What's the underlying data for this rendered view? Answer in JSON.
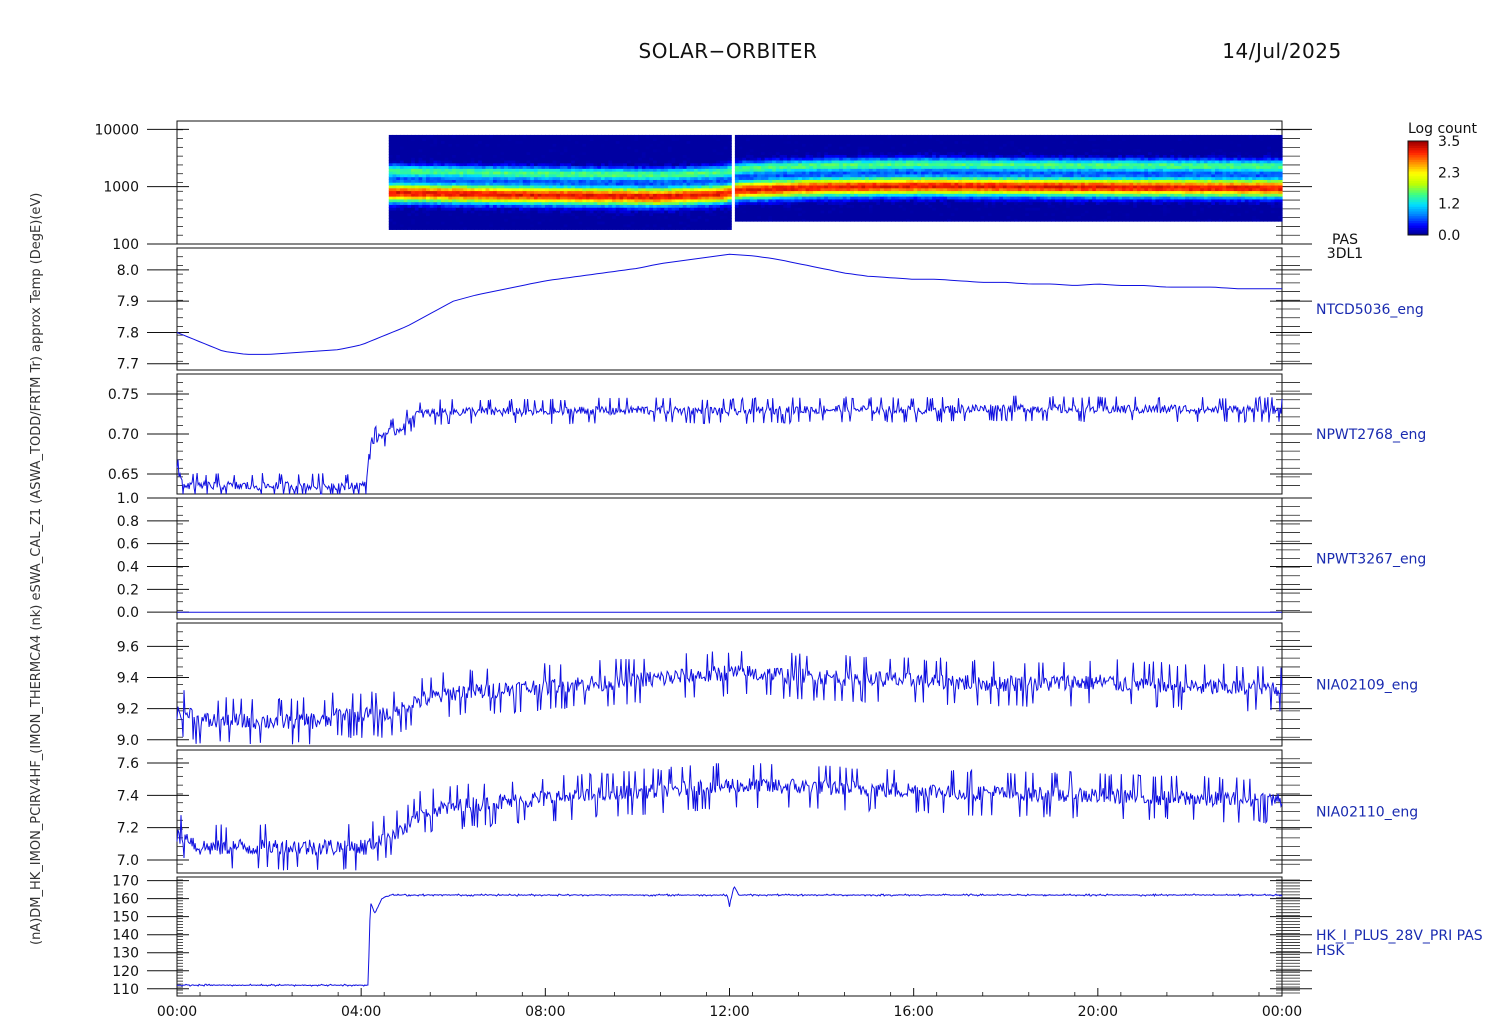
{
  "header": {
    "mission": "SOLAR−ORBITER",
    "date": "14/Jul/2025"
  },
  "left_axis_overlay": "(nA)DM_HK_IMON_PCIRV4HF_(IMON_THERMCA4 (nk) eSWA_CAL_Z1 (ASWA_TODD/FRTM Tr) approx Temp (DegE)(eV)",
  "colors": {
    "trace": "#1010e0",
    "label": "#1a2bb0",
    "colormap": [
      "#000080",
      "#0000ff",
      "#0080ff",
      "#00e0ff",
      "#40ff80",
      "#c0ff00",
      "#ffff00",
      "#ff9000",
      "#ff2000",
      "#a00000"
    ]
  },
  "colorbar": {
    "title": "Log count",
    "ticks": [
      "3.5",
      "2.3",
      "1.2",
      "0.0"
    ],
    "min": 0.0,
    "max": 3.5
  },
  "chart_data": [
    {
      "type": "heatmap",
      "panel": "PAS 3DL1",
      "right_label": [
        "PAS",
        "3DL1"
      ],
      "ylabel": "(eV)",
      "yscale": "log",
      "ylim": [
        100,
        14000
      ],
      "ytick_labels": [
        "10000",
        "1000",
        "100"
      ],
      "yticks": [
        10000,
        1000,
        100
      ],
      "x_start_hours": 4.6,
      "x_end_hours": 24.0,
      "energy_range_eV": [
        180,
        8000
      ],
      "data_gap_hours": [
        12.0,
        12.1
      ],
      "peak_energy_eV": [
        {
          "t": 4.6,
          "e": 800
        },
        {
          "t": 8.0,
          "e": 720
        },
        {
          "t": 10.5,
          "e": 680
        },
        {
          "t": 11.9,
          "e": 760
        },
        {
          "t": 12.2,
          "e": 880
        },
        {
          "t": 14.0,
          "e": 1000
        },
        {
          "t": 16.0,
          "e": 1050
        },
        {
          "t": 20.0,
          "e": 1000
        },
        {
          "t": 24.0,
          "e": 960
        }
      ]
    },
    {
      "type": "line",
      "panel": "NTCD5036_eng",
      "right_label": "NTCD5036_eng",
      "ylabel": "approx Temp (DegC)",
      "ylim": [
        7.68,
        8.07
      ],
      "yticks": [
        7.7,
        7.8,
        7.9,
        8.0
      ],
      "ytick_labels": [
        "7.7",
        "7.8",
        "7.9",
        "8.0"
      ],
      "x": [
        0,
        0.5,
        1,
        1.5,
        2,
        2.5,
        3,
        3.5,
        4,
        4.5,
        5,
        5.5,
        6,
        6.5,
        7,
        7.5,
        8,
        8.5,
        9,
        9.5,
        10,
        10.5,
        11,
        11.5,
        12,
        12.5,
        13,
        13.5,
        14,
        14.5,
        15,
        15.5,
        16,
        16.5,
        17,
        17.5,
        18,
        18.5,
        19,
        19.5,
        20,
        20.5,
        21,
        21.5,
        22,
        22.5,
        23,
        23.5,
        24
      ],
      "y": [
        7.8,
        7.77,
        7.74,
        7.73,
        7.73,
        7.735,
        7.74,
        7.745,
        7.76,
        7.79,
        7.82,
        7.86,
        7.9,
        7.92,
        7.935,
        7.95,
        7.965,
        7.975,
        7.985,
        7.995,
        8.005,
        8.02,
        8.03,
        8.04,
        8.05,
        8.045,
        8.035,
        8.02,
        8.005,
        7.99,
        7.98,
        7.975,
        7.97,
        7.97,
        7.965,
        7.96,
        7.96,
        7.955,
        7.955,
        7.95,
        7.955,
        7.95,
        7.95,
        7.945,
        7.945,
        7.945,
        7.94,
        7.94,
        7.94
      ]
    },
    {
      "type": "line",
      "panel": "NPWT2768_eng",
      "right_label": "NPWT2768_eng",
      "ylabel": "SWA_CAL_Z1 (A)",
      "ylim": [
        0.625,
        0.775
      ],
      "yticks": [
        0.65,
        0.7,
        0.75
      ],
      "ytick_labels": [
        "0.65",
        "0.70",
        "0.75"
      ],
      "x": [
        0,
        0.15,
        0.5,
        2,
        4.1,
        4.2,
        4.5,
        4.8,
        5.2,
        6,
        8,
        10,
        12,
        14,
        16,
        18,
        20,
        22,
        24
      ],
      "y": [
        0.655,
        0.636,
        0.635,
        0.635,
        0.635,
        0.69,
        0.7,
        0.705,
        0.725,
        0.728,
        0.728,
        0.73,
        0.728,
        0.731,
        0.73,
        0.732,
        0.731,
        0.731,
        0.73
      ],
      "noise": 0.018
    },
    {
      "type": "line",
      "panel": "NPWT3267_eng",
      "right_label": "NPWT3267_eng",
      "ylabel": "(nk)",
      "ylim": [
        -0.06,
        1.0
      ],
      "yticks": [
        0.0,
        0.2,
        0.4,
        0.6,
        0.8,
        1.0
      ],
      "ytick_labels": [
        "0.0",
        "0.2",
        "0.4",
        "0.6",
        "0.8",
        "1.0"
      ],
      "x": [
        0,
        24
      ],
      "y": [
        0.0,
        0.0
      ],
      "noise": 0
    },
    {
      "type": "line",
      "panel": "NIA02109_eng",
      "right_label": "NIA02109_eng",
      "ylabel": "IMON_THERMCA4",
      "ylim": [
        8.96,
        9.75
      ],
      "yticks": [
        9.0,
        9.2,
        9.4,
        9.6
      ],
      "ytick_labels": [
        "9.0",
        "9.2",
        "9.4",
        "9.6"
      ],
      "x": [
        0,
        0.3,
        0.4,
        3.3,
        3.4,
        4.7,
        5.2,
        6,
        8,
        10,
        12,
        14,
        16,
        18,
        20,
        22,
        24
      ],
      "y": [
        9.17,
        9.17,
        9.12,
        9.12,
        9.16,
        9.16,
        9.25,
        9.3,
        9.34,
        9.38,
        9.43,
        9.4,
        9.38,
        9.36,
        9.37,
        9.34,
        9.33
      ],
      "noise": 0.17
    },
    {
      "type": "line",
      "panel": "NIA02110_eng",
      "right_label": "NIA02110_eng",
      "ylabel": "PCIRV4HF",
      "ylim": [
        6.92,
        7.68
      ],
      "yticks": [
        7.0,
        7.2,
        7.4,
        7.6
      ],
      "ytick_labels": [
        "7.0",
        "7.2",
        "7.4",
        "7.6"
      ],
      "x": [
        0,
        0.3,
        0.4,
        4.1,
        4.4,
        5.0,
        5.3,
        6,
        8,
        10,
        12,
        14,
        16,
        18,
        20,
        22,
        24
      ],
      "y": [
        7.14,
        7.14,
        7.08,
        7.08,
        7.13,
        7.2,
        7.29,
        7.33,
        7.38,
        7.42,
        7.46,
        7.45,
        7.43,
        7.41,
        7.4,
        7.38,
        7.37
      ],
      "noise": 0.16
    },
    {
      "type": "line",
      "panel": "HK_I_PLUS_28V_PRI PAS HSK",
      "right_label": [
        "HK_I_PLUS_28V_PRI PAS",
        "HSK"
      ],
      "ylabel": "(nA)DM_HK_IMON",
      "ylim": [
        106,
        172
      ],
      "yticks": [
        110,
        120,
        130,
        140,
        150,
        160,
        170
      ],
      "ytick_labels": [
        "110",
        "120",
        "130",
        "140",
        "150",
        "160",
        "170"
      ],
      "x": [
        0,
        4.15,
        4.2,
        4.3,
        4.45,
        4.6,
        11.95,
        12.0,
        12.1,
        12.2,
        24
      ],
      "y": [
        112,
        112,
        158,
        152,
        160,
        162,
        162,
        156,
        167,
        162,
        162
      ],
      "noise": 0.6
    }
  ],
  "xaxis": {
    "labels": [
      "00:00",
      "04:00",
      "08:00",
      "12:00",
      "16:00",
      "20:00",
      "00:00"
    ],
    "hours": [
      0,
      4,
      8,
      12,
      16,
      20,
      24
    ]
  }
}
